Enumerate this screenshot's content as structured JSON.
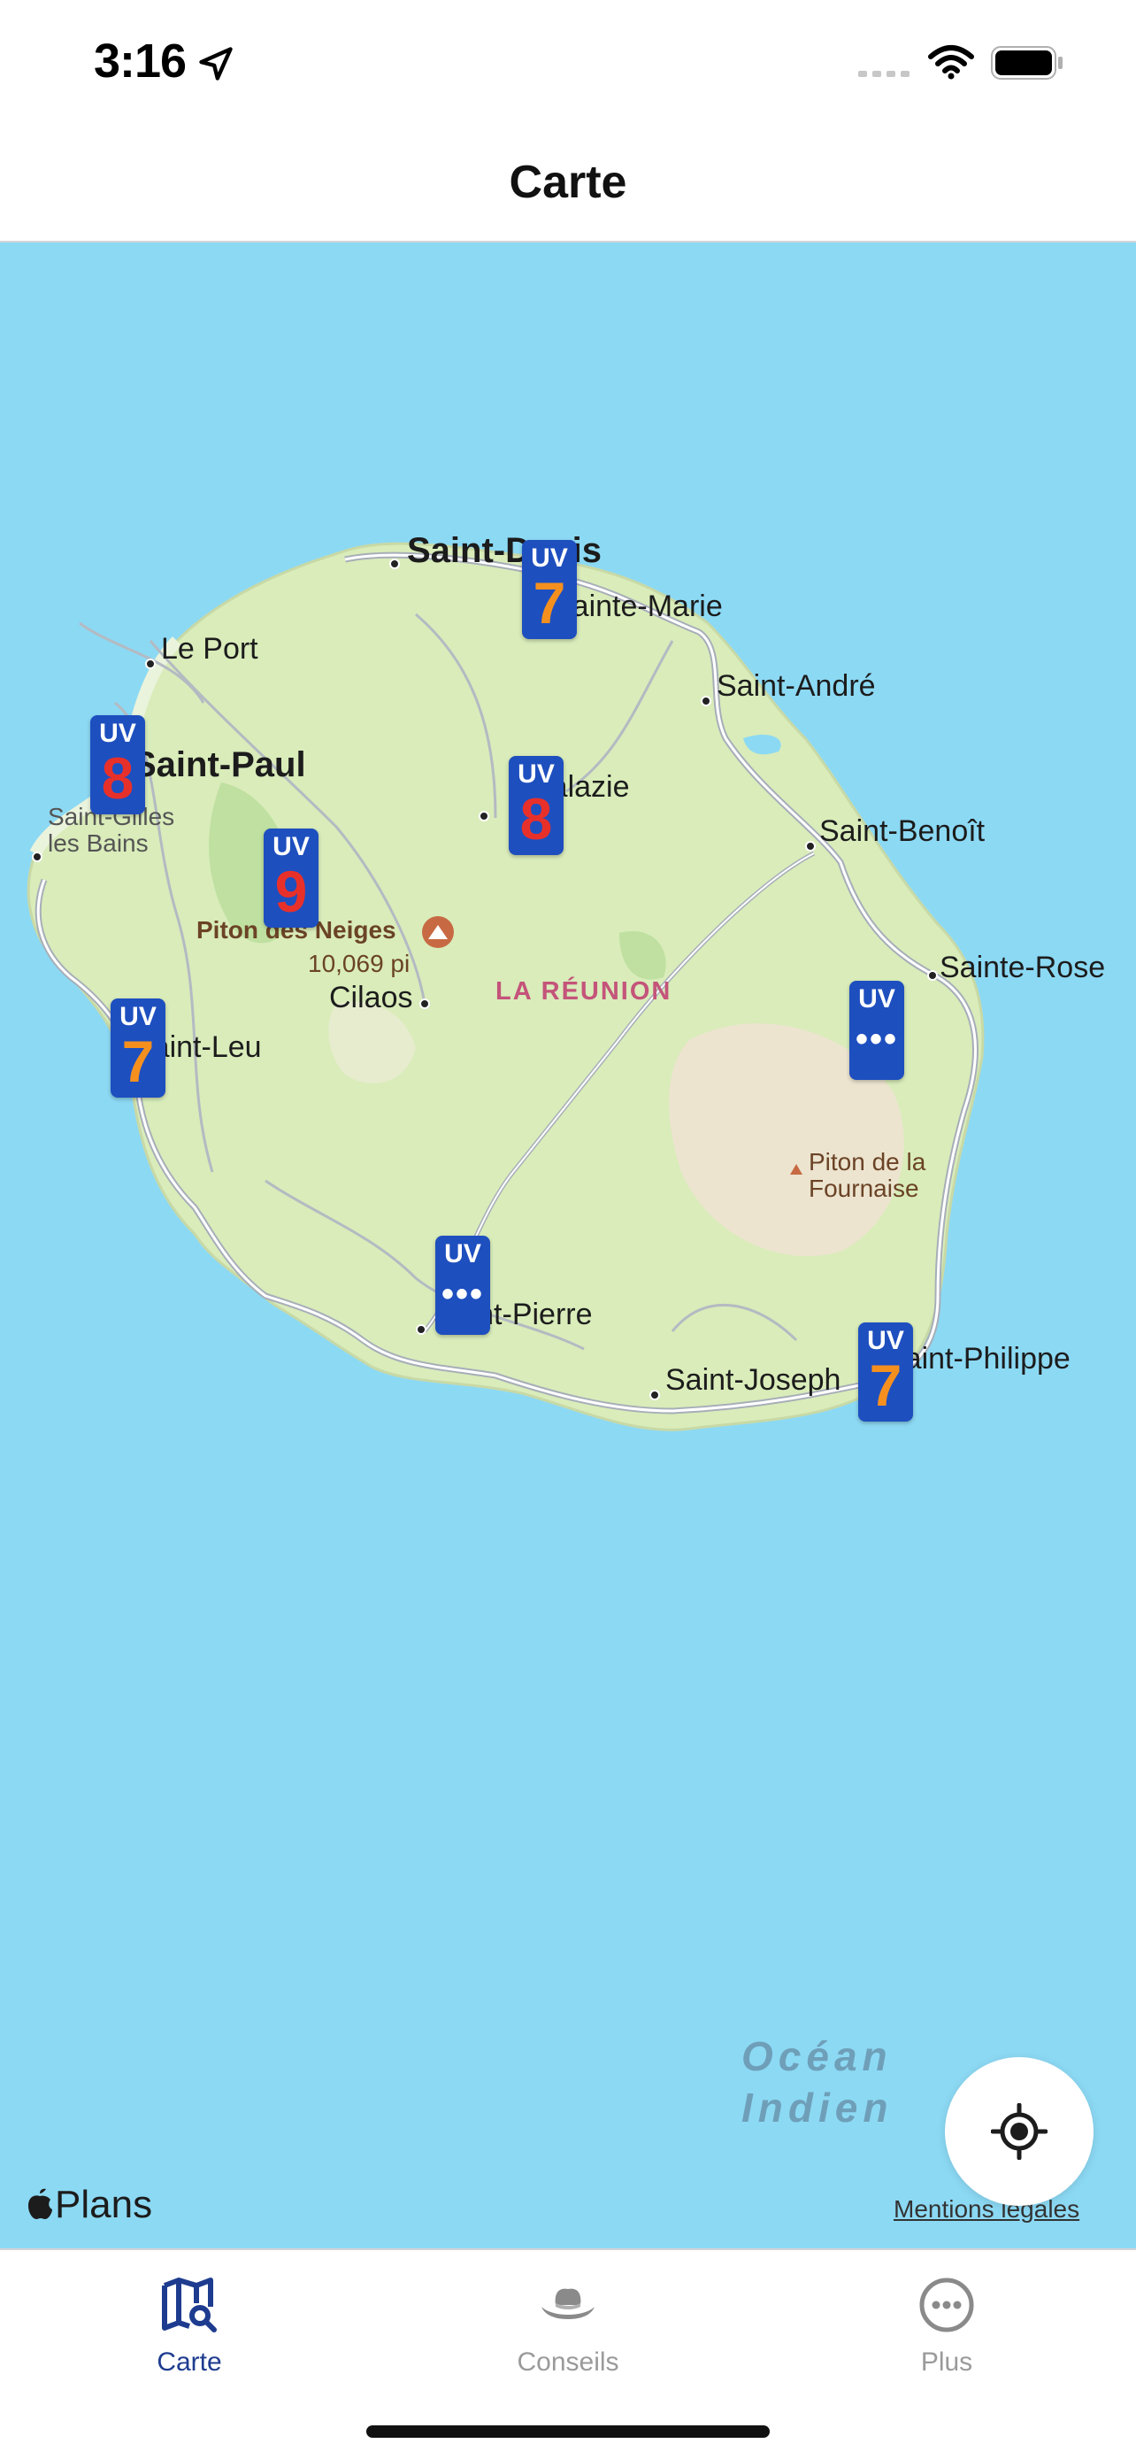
{
  "status_bar": {
    "time": "3:16"
  },
  "nav": {
    "title": "Carte"
  },
  "map": {
    "places": {
      "saint_denis": "Saint-Denis",
      "sainte_marie": "Sainte-Marie",
      "le_port": "Le Port",
      "saint_andre": "Saint-André",
      "saint_paul": "Saint-Paul",
      "salazie": "Salazie",
      "saint_gilles": "Saint-Gilles\nles Bains",
      "saint_benoit": "Saint-Benoît",
      "piton_des_neiges": "Piton des Neiges",
      "piton_elevation": "10,069 pi",
      "cilaos": "Cilaos",
      "la_reunion": "LA RÉUNION",
      "sainte_rose": "Sainte-Rose",
      "saint_leu": "Saint-Leu",
      "piton_fournaise": "Piton de la\nFournaise",
      "saint_pierre": "Saint-Pierre",
      "saint_joseph": "Saint-Joseph",
      "saint_philippe": "Saint-Philippe",
      "ocean": "Océan\nIndien"
    },
    "uv_markers": [
      {
        "label": "UV",
        "value": "7",
        "level": "orange",
        "location": "Saint-Denis"
      },
      {
        "label": "UV",
        "value": "8",
        "level": "red",
        "location": "Saint-Paul"
      },
      {
        "label": "UV",
        "value": "8",
        "level": "red",
        "location": "Salazie"
      },
      {
        "label": "UV",
        "value": "9",
        "level": "red",
        "location": "Piton des Neiges"
      },
      {
        "label": "UV",
        "value": "7",
        "level": "orange",
        "location": "Saint-Leu"
      },
      {
        "label": "UV",
        "value": "•••",
        "level": "dots",
        "location": "Sainte-Rose"
      },
      {
        "label": "UV",
        "value": "•••",
        "level": "dots",
        "location": "Saint-Pierre"
      },
      {
        "label": "UV",
        "value": "7",
        "level": "orange",
        "location": "Saint-Philippe"
      }
    ],
    "attribution": "Plans",
    "legal": "Mentions légales"
  },
  "tabs": [
    {
      "label": "Carte",
      "icon": "map-search-icon",
      "active": true
    },
    {
      "label": "Conseils",
      "icon": "hat-icon",
      "active": false
    },
    {
      "label": "Plus",
      "icon": "more-icon",
      "active": false
    }
  ],
  "colors": {
    "ocean": "#8cd9f4",
    "land": "#d8ebb9",
    "marker": "#1e4fbf",
    "uv_orange": "#f5901f",
    "uv_red": "#e8302a",
    "tab_active": "#1e3c8f"
  }
}
